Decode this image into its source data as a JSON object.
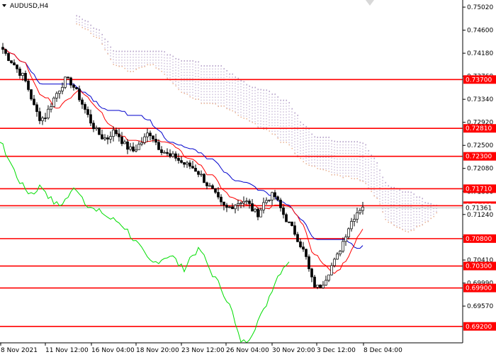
{
  "window": {
    "symbol_label": "AUDUSD,H4"
  },
  "colors": {
    "background": "#ffffff",
    "axis": "#000000",
    "level_line": "#ff0000",
    "level_label_bg": "#ff0000",
    "level_label_text": "#ffffff",
    "bull_candle": "#ffffff",
    "bear_candle": "#000000",
    "tenkan": "#ff0000",
    "kijun": "#0000cc",
    "chikou": "#00dd00",
    "kumo_up": "#b4a0c8",
    "kumo_down": "#e8b090",
    "bid_line": "#c0c0c0"
  },
  "chart_data": {
    "type": "candlestick",
    "title": "AUDUSD,H4",
    "indicator": "Ichimoku",
    "ylim": [
      0.689,
      0.7515
    ],
    "y_ticks": [
      "0.75020",
      "0.74600",
      "0.74180",
      "0.73760",
      "0.73340",
      "0.72920",
      "0.72500",
      "0.72080",
      "0.71660",
      "0.71240",
      "0.70830",
      "0.70410",
      "0.69990",
      "0.69570"
    ],
    "x_ticks": [
      "8 Nov 2021",
      "11 Nov 12:00",
      "16 Nov 04:00",
      "18 Nov 20:00",
      "23 Nov 12:00",
      "26 Nov 04:00",
      "30 Nov 20:00",
      "3 Dec 12:00",
      "8 Dec 04:00"
    ],
    "levels": [
      0.737,
      0.7281,
      0.723,
      0.7171,
      0.714,
      0.708,
      0.703,
      0.699,
      0.692
    ],
    "level_labels": [
      "0.73700",
      "0.72810",
      "0.72300",
      "0.71710",
      "0.71400",
      "0.70800",
      "0.70300",
      "0.69900",
      "0.69200"
    ],
    "current_price": 0.7136,
    "current_price_label": "0.71361",
    "price_path": [
      0.7425,
      0.741,
      0.74,
      0.7385,
      0.7375,
      0.735,
      0.732,
      0.73,
      0.73,
      0.732,
      0.734,
      0.7355,
      0.737,
      0.7365,
      0.735,
      0.733,
      0.731,
      0.729,
      0.7275,
      0.7265,
      0.7262,
      0.7275,
      0.7272,
      0.7255,
      0.7245,
      0.724,
      0.725,
      0.726,
      0.7275,
      0.7262,
      0.7245,
      0.7238,
      0.7228,
      0.723,
      0.722,
      0.7215,
      0.7212,
      0.7205,
      0.7195,
      0.718,
      0.717,
      0.7155,
      0.714,
      0.7135,
      0.714,
      0.7145,
      0.715,
      0.7145,
      0.713,
      0.7125,
      0.7145,
      0.7155,
      0.716,
      0.714,
      0.712,
      0.7105,
      0.709,
      0.707,
      0.705,
      0.701,
      0.699,
      0.6995,
      0.701,
      0.703,
      0.7045,
      0.707,
      0.7095,
      0.7115,
      0.713,
      0.714
    ]
  }
}
